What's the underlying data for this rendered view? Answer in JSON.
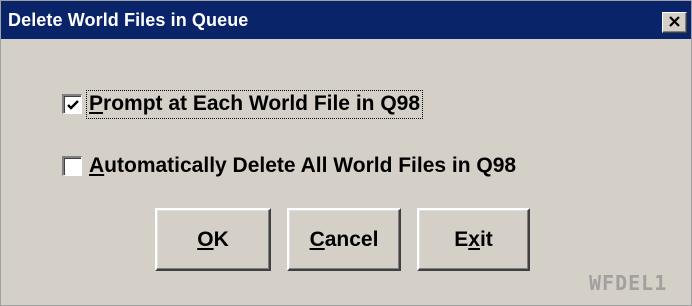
{
  "dialog": {
    "title": "Delete World Files in Queue",
    "close_icon": "close-icon"
  },
  "options": [
    {
      "checked": true,
      "accel": "P",
      "rest": "rompt at Each World File in Q98"
    },
    {
      "checked": false,
      "accel": "A",
      "rest": "utomatically Delete All World Files in Q98"
    }
  ],
  "buttons": {
    "ok": {
      "accel": "O",
      "rest": "K"
    },
    "cancel": {
      "accel": "C",
      "rest": "ancel"
    },
    "exit": {
      "pre": "E",
      "accel": "x",
      "rest": "it"
    }
  },
  "form_code": "WFDEL1",
  "colors": {
    "title_bar": "#0a246a",
    "face": "#d4d0c8"
  }
}
